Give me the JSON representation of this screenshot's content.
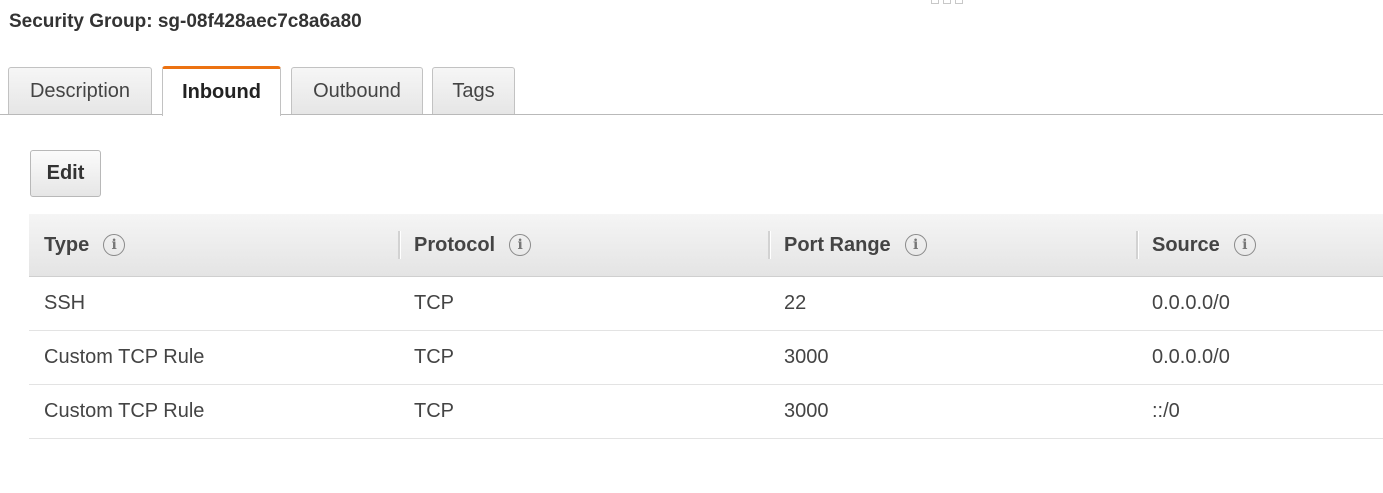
{
  "title": "Security Group: sg-08f428aec7c8a6a80",
  "tabs": [
    {
      "label": "Description",
      "active": false
    },
    {
      "label": "Inbound",
      "active": true
    },
    {
      "label": "Outbound",
      "active": false
    },
    {
      "label": "Tags",
      "active": false
    }
  ],
  "edit_label": "Edit",
  "accent_color": "#ec7211",
  "table": {
    "columns": [
      "Type",
      "Protocol",
      "Port Range",
      "Source"
    ],
    "rows": [
      [
        "SSH",
        "TCP",
        "22",
        "0.0.0.0/0"
      ],
      [
        "Custom TCP Rule",
        "TCP",
        "3000",
        "0.0.0.0/0"
      ],
      [
        "Custom TCP Rule",
        "TCP",
        "3000",
        "::/0"
      ]
    ]
  },
  "icons": {
    "info": "info-icon",
    "drag": "drag-handle-icon"
  }
}
